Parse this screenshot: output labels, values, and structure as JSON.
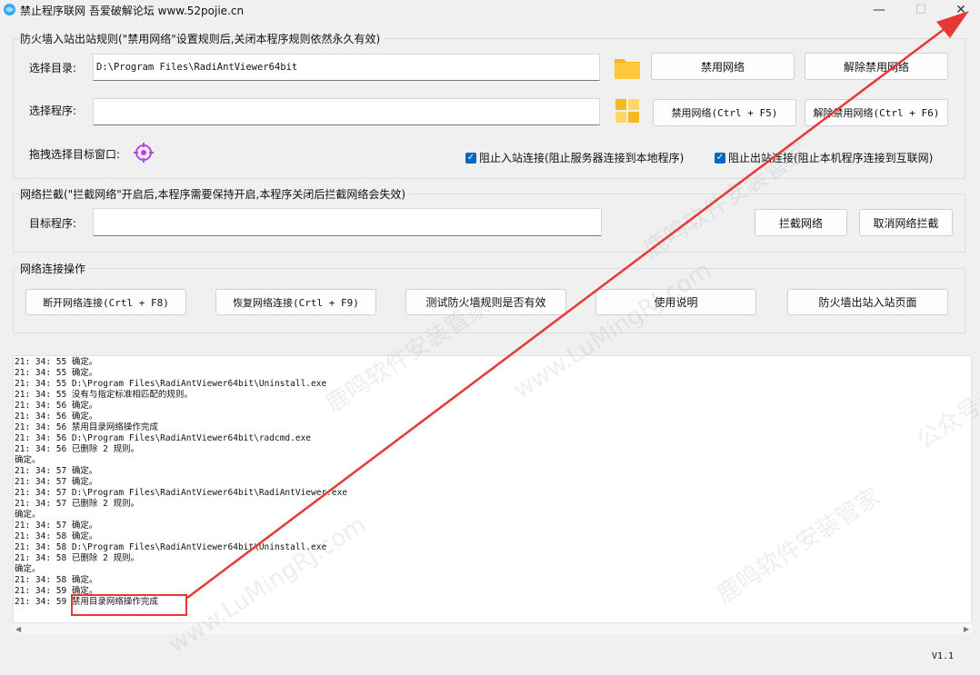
{
  "titlebar": {
    "title": "禁止程序联网 吾爱破解论坛 www.52pojie.cn",
    "minimize": "—",
    "maximize": "☐",
    "close": "✕"
  },
  "firewall": {
    "group_title": "防火墙入站出站规则(\"禁用网络\"设置规则后,关闭本程序规则依然永久有效)",
    "dir_label": "选择目录:",
    "dir_value": "D:\\Program Files\\RadiAntViewer64bit",
    "prog_label": "选择程序:",
    "prog_value": "",
    "drag_label": "拖拽选择目标窗口:",
    "btn_disable": "禁用网络",
    "btn_enable": "解除禁用网络",
    "btn_disable_hotkey": "禁用网络(Ctrl + F5)",
    "btn_enable_hotkey": "解除禁用网络(Ctrl + F6)",
    "check_inbound": "阻止入站连接(阻止服务器连接到本地程序)",
    "check_outbound": "阻止出站连接(阻止本机程序连接到互联网)"
  },
  "intercept": {
    "group_title": "网络拦截(\"拦截网络\"开启后,本程序需要保持开启,本程序关闭后拦截网络会失效)",
    "target_label": "目标程序:",
    "target_value": "",
    "btn_intercept": "拦截网络",
    "btn_cancel": "取消网络拦截"
  },
  "netops": {
    "group_title": "网络连接操作",
    "btn_disconnect": "断开网络连接(Crtl + F8)",
    "btn_restore": "恢复网络连接(Crtl + F9)",
    "btn_test": "测试防火墙规则是否有效",
    "btn_help": "使用说明",
    "btn_firewall_page": "防火墙出站入站页面"
  },
  "log": [
    "21: 34: 55 确定。",
    "21: 34: 55 确定。",
    "21: 34: 55 D:\\Program Files\\RadiAntViewer64bit\\Uninstall.exe",
    "21: 34: 55 没有与指定标准相匹配的规则。",
    "21: 34: 56 确定。",
    "21: 34: 56 确定。",
    "21: 34: 56 禁用目录网络操作完成",
    "21: 34: 56 D:\\Program Files\\RadiAntViewer64bit\\radcmd.exe",
    "21: 34: 56 已删除 2 规则。",
    "确定。",
    "21: 34: 57 确定。",
    "21: 34: 57 确定。",
    "21: 34: 57 D:\\Program Files\\RadiAntViewer64bit\\RadiAntViewer.exe",
    "21: 34: 57 已删除 2 规则。",
    "确定。",
    "21: 34: 57 确定。",
    "21: 34: 58 确定。",
    "21: 34: 58 D:\\Program Files\\RadiAntViewer64bit\\Uninstall.exe",
    "21: 34: 58 已删除 2 规则。",
    "确定。",
    "21: 34: 58 确定。",
    "21: 34: 59 确定。",
    "21: 34: 59 禁用目录网络操作完成"
  ],
  "version": "V1.1",
  "watermark": {
    "text_a": "鹿鸣软件安装管家",
    "text_b": "www.LuMingRJ.com",
    "text_c": "公众号:"
  },
  "colors": {
    "accent": "#0067c0",
    "annotation": "#e53935",
    "folder": "#f6b820"
  },
  "icons": {
    "app": "app-icon",
    "folder": "folder-icon",
    "program": "program-grid-icon",
    "crosshair": "crosshair-icon"
  }
}
